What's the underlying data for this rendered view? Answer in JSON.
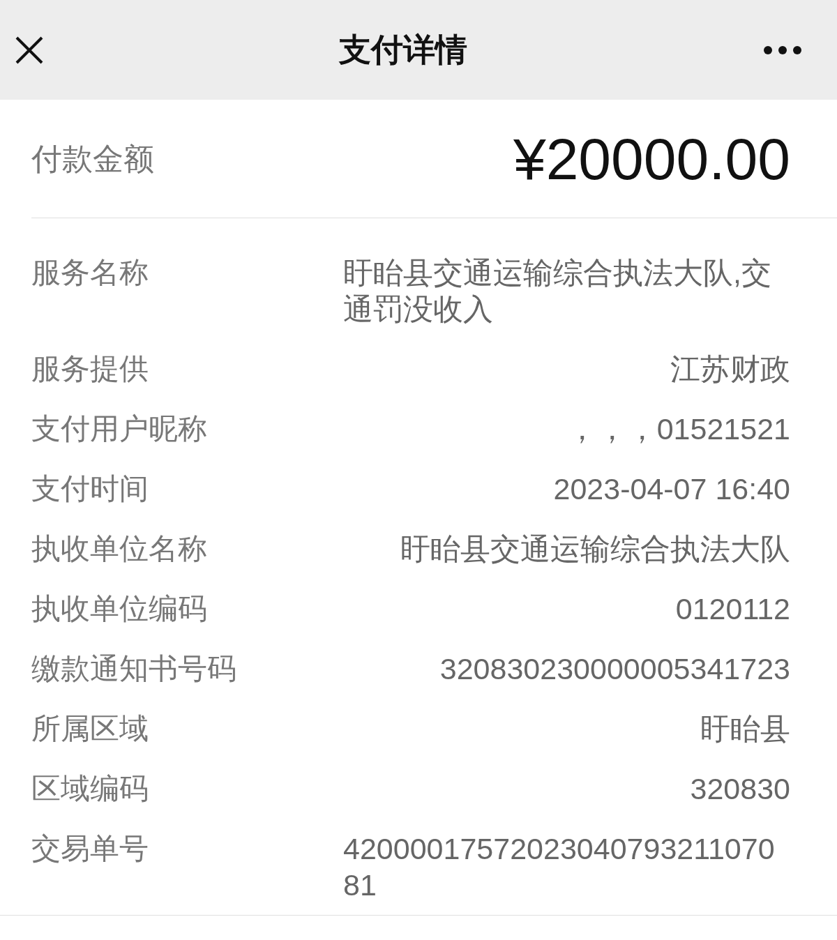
{
  "header": {
    "title": "支付详情"
  },
  "amount": {
    "label": "付款金额",
    "value": "¥20000.00"
  },
  "details": [
    {
      "kind": "wrap",
      "label": "服务名称",
      "value": "盱眙县交通运输综合执法大队,交通罚没收入"
    },
    {
      "kind": "single",
      "label": "服务提供",
      "value": "江苏财政"
    },
    {
      "kind": "single",
      "label": "支付用户昵称",
      "value": "，，，01521521"
    },
    {
      "kind": "single",
      "label": "支付时间",
      "value": "2023-04-07 16:40"
    },
    {
      "kind": "single",
      "label": "执收单位名称",
      "value": "盱眙县交通运输综合执法大队"
    },
    {
      "kind": "single",
      "label": "执收单位编码",
      "value": "0120112"
    },
    {
      "kind": "single",
      "label": "缴款通知书号码",
      "value": "320830230000005341723"
    },
    {
      "kind": "single",
      "label": "所属区域",
      "value": "盱眙县"
    },
    {
      "kind": "single",
      "label": "区域编码",
      "value": "320830"
    },
    {
      "kind": "wrap",
      "label": "交易单号",
      "value": "4200001757202304079321107081"
    }
  ]
}
